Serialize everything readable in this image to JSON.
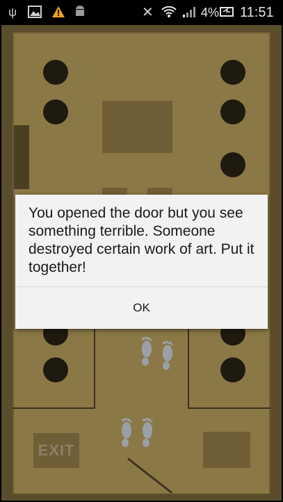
{
  "status_bar": {
    "usb_icon": "usb-icon",
    "gallery_icon": "image-icon",
    "warning_icon": "warning-icon",
    "android_icon": "android-icon",
    "mute_icon": "mute-icon",
    "wifi_icon": "wifi-icon",
    "signal_icon": "signal-icon",
    "battery_percent": "4%",
    "battery_icon": "battery-charging-icon",
    "time": "11:51"
  },
  "game": {
    "exit_label": "EXIT",
    "footprints_icon": "footprints-icon"
  },
  "dialog": {
    "message": "You opened the door but you see something terrible. Someone destroyed certain work of art. Put it together!",
    "ok_label": "OK"
  }
}
